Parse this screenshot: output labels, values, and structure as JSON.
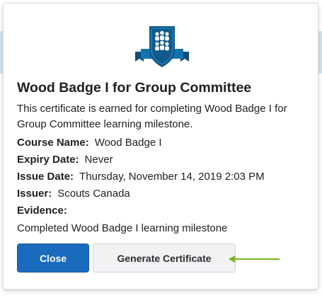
{
  "dialog": {
    "title": "Wood Badge I for Group Committee",
    "description": "This certificate is earned for completing Wood Badge I for Group Committee learning milestone.",
    "details": {
      "course_name_label": "Course Name:",
      "course_name_value": "Wood Badge I",
      "expiry_date_label": "Expiry Date:",
      "expiry_date_value": "Never",
      "issue_date_label": "Issue Date:",
      "issue_date_value": "Thursday, November 14, 2019 2:03 PM",
      "issuer_label": "Issuer:",
      "issuer_value": "Scouts Canada",
      "evidence_label": "Evidence:",
      "evidence_value": "Completed Wood Badge I learning milestone"
    },
    "buttons": {
      "close_label": "Close",
      "generate_label": "Generate Certificate"
    },
    "badge_icon": "group-badge-icon",
    "annotation_icon": "green-arrow-icon"
  },
  "colors": {
    "primary_button": "#1a6bbd",
    "badge_shield": "#0f5a8a",
    "badge_banner": "#1372b0",
    "arrow": "#7ab51d"
  }
}
